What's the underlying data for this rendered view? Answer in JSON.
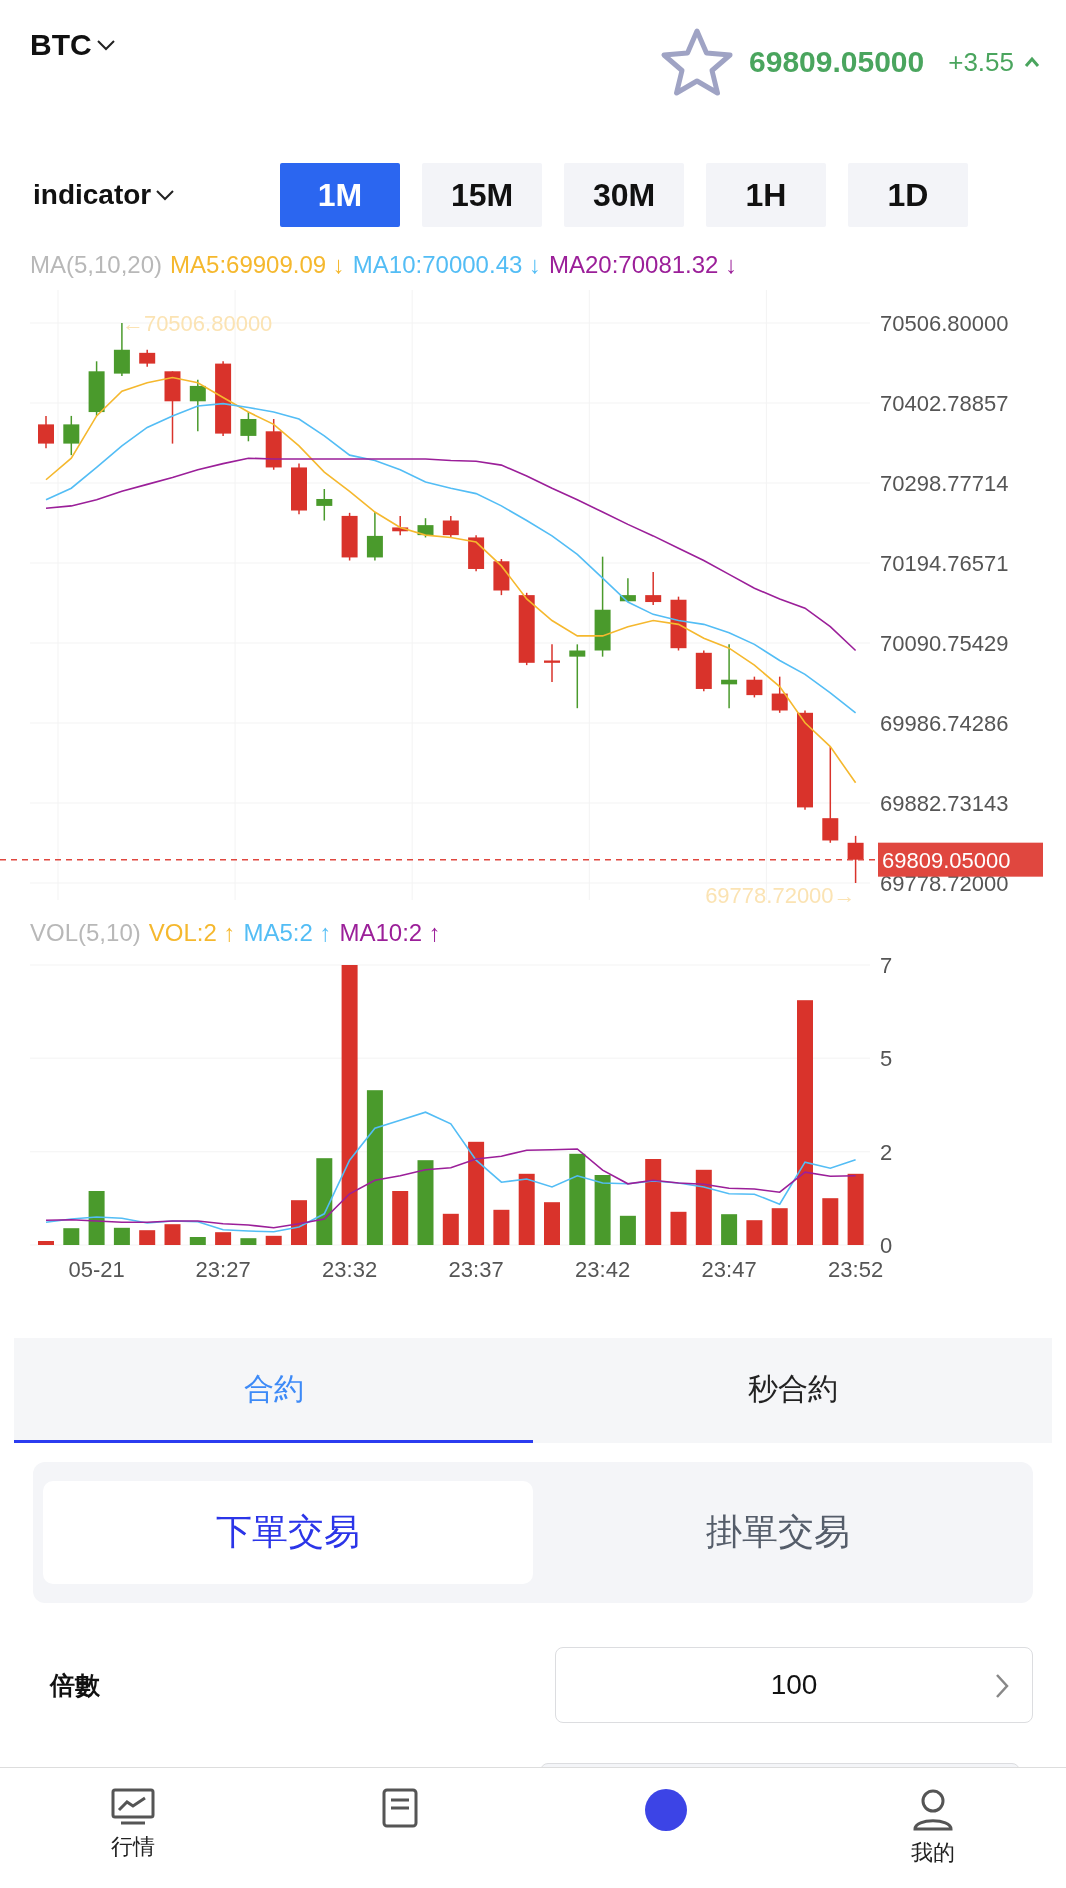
{
  "header": {
    "symbol": "BTC",
    "favorite": false,
    "price": "69809.05000",
    "change": "+3.55",
    "rising": true
  },
  "toolbar": {
    "indicator": "indicator",
    "timeframes": [
      {
        "label": "1M",
        "selected": true
      },
      {
        "label": "15M",
        "selected": false
      },
      {
        "label": "30M",
        "selected": false
      },
      {
        "label": "1H",
        "selected": false
      },
      {
        "label": "1D",
        "selected": false
      }
    ]
  },
  "price_chart": {
    "legend": [
      {
        "text": "MA(5,10,20)",
        "color": "#b8b8b8"
      },
      {
        "text": "MA5:69909.09 ↓",
        "color": "#f5b82e"
      },
      {
        "text": "MA10:70000.43 ↓",
        "color": "#53bdf5"
      },
      {
        "text": "MA20:70081.32 ↓",
        "color": "#9b1f99"
      }
    ],
    "max_marker": "←70506.80000",
    "min_marker": "69778.72000→",
    "chart_data": {
      "type": "candlestick",
      "grid": true,
      "ylim": [
        69778.72,
        70506.8
      ],
      "yticks": [
        {
          "value": 70506.8,
          "label": "70506.80000"
        },
        {
          "value": 70402.78857,
          "label": "70402.78857"
        },
        {
          "value": 70298.77714,
          "label": "70298.77714"
        },
        {
          "value": 70194.76571,
          "label": "70194.76571"
        },
        {
          "value": 70090.75429,
          "label": "70090.75429"
        },
        {
          "value": 69986.74286,
          "label": "69986.74286"
        },
        {
          "value": 69882.73143,
          "label": "69882.73143"
        },
        {
          "value": 69778.72,
          "label": "69778.72000"
        }
      ],
      "ohlc": [
        [
          70375,
          70386,
          70344,
          70350
        ],
        [
          70350,
          70386,
          70335,
          70375
        ],
        [
          70391,
          70457,
          70386,
          70444
        ],
        [
          70441,
          70506.8,
          70438,
          70472
        ],
        [
          70468,
          70472,
          70450,
          70454
        ],
        [
          70444,
          70444,
          70350,
          70405
        ],
        [
          70405,
          70433,
          70366,
          70425
        ],
        [
          70454,
          70457,
          70360,
          70363
        ],
        [
          70360,
          70391,
          70353,
          70382
        ],
        [
          70366,
          70382,
          70316,
          70319
        ],
        [
          70319,
          70324,
          70258,
          70263
        ],
        [
          70269,
          70291,
          70250,
          70278
        ],
        [
          70256,
          70260,
          70198,
          70202
        ],
        [
          70202,
          70261,
          70198,
          70230
        ],
        [
          70241,
          70256,
          70231,
          70236
        ],
        [
          70231,
          70253,
          70228,
          70244
        ],
        [
          70250,
          70256,
          70228,
          70231
        ],
        [
          70228,
          70231,
          70184,
          70187
        ],
        [
          70197,
          70200,
          70153,
          70159
        ],
        [
          70153,
          70156,
          70062,
          70065
        ],
        [
          70068,
          70089,
          70040,
          70065
        ],
        [
          70073,
          70089,
          70006,
          70081
        ],
        [
          70081,
          70203,
          70073,
          70134
        ],
        [
          70145,
          70175,
          70144,
          70153
        ],
        [
          70153,
          70183,
          70140,
          70144
        ],
        [
          70147,
          70151,
          70081,
          70084
        ],
        [
          70078,
          70081,
          70028,
          70031
        ],
        [
          70037,
          70089,
          70006,
          70043
        ],
        [
          70043,
          70047,
          70020,
          70023
        ],
        [
          70025,
          70047,
          70000,
          70003
        ],
        [
          70000,
          70003,
          69874,
          69877
        ],
        [
          69863,
          69956,
          69831,
          69834
        ],
        [
          69831,
          69840,
          69778.72,
          69809.05
        ]
      ],
      "series": [
        {
          "type": "line",
          "color": "#f5b82e",
          "values": [
            70303,
            70331,
            70386,
            70418,
            70429,
            70436,
            70429,
            70410,
            70391,
            70375,
            70347,
            70313,
            70288,
            70261,
            70241,
            70231,
            70228,
            70222,
            70191,
            70148,
            70120,
            70100,
            70100,
            70112,
            70120,
            70115,
            70097,
            70084,
            70062,
            70034,
            69987,
            69956,
            69909
          ]
        },
        {
          "type": "line",
          "color": "#53bdf5",
          "values": [
            70277,
            70292,
            70319,
            70347,
            70371,
            70386,
            70399,
            70402,
            70397,
            70391,
            70382,
            70360,
            70335,
            70328,
            70316,
            70300,
            70292,
            70285,
            70269,
            70250,
            70230,
            70206,
            70175,
            70144,
            70128,
            70120,
            70115,
            70104,
            70089,
            70068,
            70050,
            70026,
            70000
          ]
        },
        {
          "type": "line",
          "color": "#9b1f99",
          "values": [
            70266,
            70269,
            70277,
            70288,
            70297,
            70306,
            70316,
            70324,
            70331,
            70330,
            70330,
            70330,
            70330,
            70330,
            70330,
            70330,
            70328,
            70327,
            70322,
            70308,
            70292,
            70277,
            70261,
            70245,
            70230,
            70214,
            70198,
            70180,
            70162,
            70148,
            70136,
            70112,
            70081
          ]
        }
      ],
      "ref_lines": [
        {
          "axis": "y",
          "value": 69809.05,
          "color": "#e0473f",
          "label": "69809.05000"
        }
      ]
    }
  },
  "volume_chart": {
    "legend": [
      {
        "text": "VOL(5,10)",
        "color": "#b8b8b8"
      },
      {
        "text": "VOL:2 ↑",
        "color": "#f5b82e"
      },
      {
        "text": "MA5:2 ↑",
        "color": "#53bdf5"
      },
      {
        "text": "MA10:2 ↑",
        "color": "#9b1f99"
      }
    ],
    "chart_data": {
      "type": "bar",
      "grid": true,
      "ylim": [
        0,
        7
      ],
      "categories": [
        null,
        null,
        "05-21",
        null,
        null,
        null,
        null,
        "23:27",
        null,
        null,
        null,
        null,
        "23:32",
        null,
        null,
        null,
        null,
        "23:37",
        null,
        null,
        null,
        null,
        "23:42",
        null,
        null,
        null,
        null,
        "23:47",
        null,
        null,
        null,
        null,
        "23:52"
      ],
      "yticks": [
        {
          "value": 0,
          "label": "0"
        },
        {
          "value": 2.33,
          "label": "2"
        },
        {
          "value": 4.67,
          "label": "5"
        },
        {
          "value": 7,
          "label": "7"
        }
      ],
      "colors": [
        "#d9332b",
        "#4a9a2c",
        "#4a9a2c",
        "#4a9a2c",
        "#d9332b",
        "#d9332b",
        "#4a9a2c",
        "#d9332b",
        "#4a9a2c",
        "#d9332b",
        "#d9332b",
        "#4a9a2c",
        "#d9332b",
        "#4a9a2c",
        "#d9332b",
        "#4a9a2c",
        "#d9332b",
        "#d9332b",
        "#d9332b",
        "#d9332b",
        "#d9332b",
        "#4a9a2c",
        "#4a9a2c",
        "#4a9a2c",
        "#d9332b",
        "#d9332b",
        "#d9332b",
        "#4a9a2c",
        "#d9332b",
        "#d9332b",
        "#d9332b",
        "#d9332b",
        "#d9332b"
      ],
      "values": [
        0.1,
        0.42,
        1.35,
        0.43,
        0.37,
        0.52,
        0.2,
        0.32,
        0.17,
        0.23,
        1.12,
        2.17,
        7,
        3.87,
        1.35,
        2.12,
        0.78,
        2.58,
        0.88,
        1.78,
        1.07,
        2.28,
        1.75,
        0.73,
        2.15,
        0.83,
        1.88,
        0.77,
        0.62,
        0.92,
        6.12,
        1.17,
        1.78
      ],
      "series": [
        {
          "type": "line",
          "color": "#53bdf5",
          "values": [
            0.57,
            0.65,
            0.7,
            0.67,
            0.55,
            0.6,
            0.58,
            0.38,
            0.35,
            0.33,
            0.45,
            0.78,
            2.12,
            2.92,
            3.12,
            3.32,
            3.03,
            2.12,
            1.57,
            1.65,
            1.45,
            1.73,
            1.55,
            1.53,
            1.6,
            1.55,
            1.45,
            1.28,
            1.27,
            1.02,
            2.07,
            1.92,
            2.13
          ]
        },
        {
          "type": "line",
          "color": "#9b1f99",
          "values": [
            0.62,
            0.63,
            0.6,
            0.57,
            0.57,
            0.6,
            0.6,
            0.53,
            0.5,
            0.43,
            0.53,
            0.65,
            1.28,
            1.62,
            1.73,
            1.88,
            1.93,
            2.15,
            2.22,
            2.37,
            2.38,
            2.4,
            1.87,
            1.53,
            1.62,
            1.55,
            1.52,
            1.42,
            1.4,
            1.32,
            1.82,
            1.72,
            1.73
          ]
        }
      ]
    }
  },
  "tabs": [
    {
      "label": "合約",
      "selected": true
    },
    {
      "label": "秒合約",
      "selected": false
    }
  ],
  "order_modes": [
    {
      "label": "下單交易",
      "selected": true
    },
    {
      "label": "掛單交易",
      "selected": false
    }
  ],
  "form": {
    "fields": [
      {
        "label": "倍數",
        "value": "100"
      }
    ]
  },
  "bottom_nav": [
    {
      "label": "行情",
      "kind": "chart"
    },
    {
      "kind": "document"
    },
    {
      "kind": "circle"
    },
    {
      "label": "我的",
      "kind": "person"
    }
  ]
}
